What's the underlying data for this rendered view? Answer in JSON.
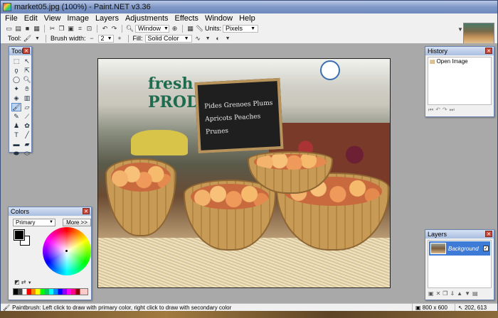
{
  "window": {
    "title": "market05.jpg (100%) - Paint.NET v3.36"
  },
  "menu": [
    "File",
    "Edit",
    "View",
    "Image",
    "Layers",
    "Adjustments",
    "Effects",
    "Window",
    "Help"
  ],
  "toolbar": {
    "window_label": "Window",
    "units_label": "Units:",
    "units_value": "Pixels",
    "tool_label": "Tool:",
    "brush_width_label": "Brush width:",
    "brush_width_value": "2",
    "fill_label": "Fill:",
    "fill_value": "Solid Color"
  },
  "canvas": {
    "store_sign": "fresh PRODU",
    "chalk_lines": [
      "Pides  Grenoes  Plums",
      "Apricots  Peaches  Prunes"
    ]
  },
  "tools_panel": {
    "title": "Tools"
  },
  "history_panel": {
    "title": "History",
    "items": [
      "Open Image"
    ]
  },
  "colors_panel": {
    "title": "Colors",
    "mode_value": "Primary",
    "more_label": "More >>",
    "primary_color": "#000000",
    "secondary_color": "#ffffff"
  },
  "layers_panel": {
    "title": "Layers",
    "layer_name": "Background",
    "layer_visible": true
  },
  "status": {
    "message": "Paintbrush: Left click to draw with primary color, right click to draw with secondary color",
    "image_size": "800 x 600",
    "cursor_pos": "202, 613"
  }
}
